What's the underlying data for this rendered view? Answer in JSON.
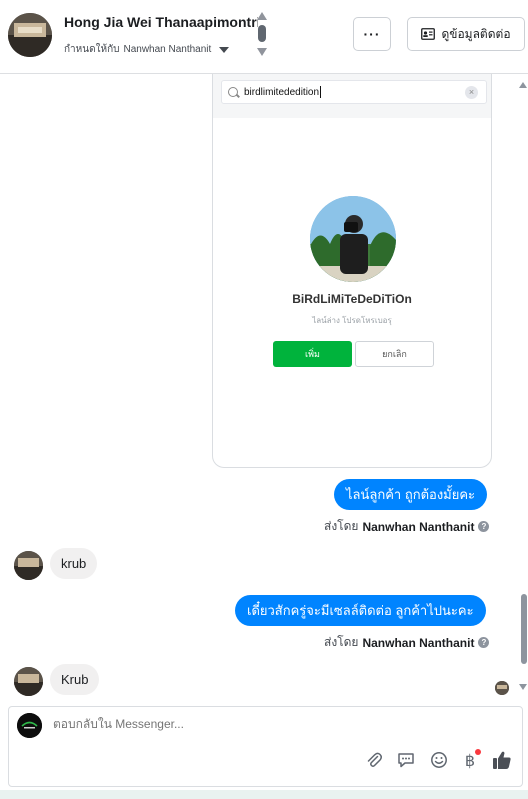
{
  "header": {
    "contact_name": "Hong Jia Wei Thanaapimontri",
    "assigned_prefix": "กำหนดให้กับ",
    "assigned_to": "Nanwhan Nanthanit",
    "more_label": "···",
    "view_contact_label": "ดูข้อมูลติดต่อ"
  },
  "shared_screenshot": {
    "search_query": "birdlimitededition",
    "profile_name": "BiRdLiMiTeDeDiTiOn",
    "profile_subtitle": "ไลน์ล่าง โปรดโหรเบอรุ",
    "add_label": "เพิ่ม",
    "cancel_label": "ยกเลิก"
  },
  "messages": [
    {
      "direction": "out",
      "text": "ไลน์ลูกค้า ถูกต้องมั้ยคะ",
      "sent_by_prefix": "ส่งโดย",
      "sent_by": "Nanwhan Nanthanit"
    },
    {
      "direction": "in",
      "text": "krub"
    },
    {
      "direction": "out",
      "text": "เดี๋ยวสักครู่จะมีเซลล์ติดต่อ ลูกค้าไปนะคะ",
      "sent_by_prefix": "ส่งโดย",
      "sent_by": "Nanwhan Nanthanit"
    },
    {
      "direction": "in",
      "text": "Krub"
    }
  ],
  "composer": {
    "placeholder": "ตอบกลับใน Messenger...",
    "baht_icon": "฿"
  },
  "colors": {
    "outgoing_bubble": "#0084ff",
    "incoming_bubble": "#f1f0f0",
    "add_button": "#00b33c",
    "like_icon": "#4b4f56"
  },
  "icons": [
    "chevron-up-icon",
    "chevron-down-icon",
    "more-icon",
    "contact-card-icon",
    "search-icon",
    "clear-icon",
    "question-icon",
    "attachment-icon",
    "saved-replies-icon",
    "emoji-icon",
    "baht-icon",
    "thumbs-up-icon"
  ]
}
